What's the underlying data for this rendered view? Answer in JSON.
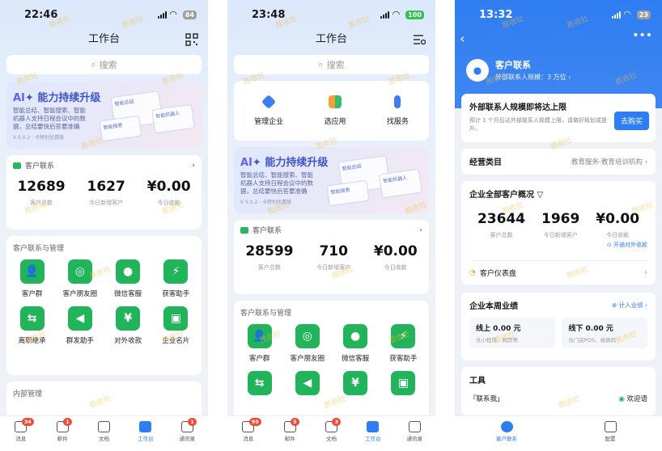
{
  "phone1": {
    "time": "22:46",
    "battery": "84",
    "title": "工作台",
    "search_placeholder": "搜索",
    "banner": {
      "title_ai": "AI",
      "title_rest": "能力持续升级",
      "desc": "智能总结、智能搜索、智能机器人支持日程会议中的数据，总结要快后答要准确",
      "ver": "V 5.0.2 · 卡特别优惠版",
      "cards": [
        "智能总结",
        "智能机器人",
        "智能搜索",
        "帮助中心"
      ]
    },
    "contacts": {
      "header": "客户联系",
      "stats": [
        {
          "value": "12689",
          "label": "客户总数"
        },
        {
          "value": "1627",
          "label": "今日新增客户"
        },
        {
          "value": "¥0.00",
          "label": "今日收款"
        }
      ]
    },
    "section": "客户联系与管理",
    "apps": [
      {
        "label": "客户群",
        "icon": "group-icon",
        "glyph": "👥"
      },
      {
        "label": "客户朋友圈",
        "icon": "moments-icon",
        "glyph": "◎"
      },
      {
        "label": "微信客服",
        "icon": "chat-icon",
        "glyph": "💬"
      },
      {
        "label": "获客助手",
        "icon": "bolt-icon",
        "glyph": "⚡"
      },
      {
        "label": "离职继承",
        "icon": "transfer-icon",
        "glyph": "⇆"
      },
      {
        "label": "群发助手",
        "icon": "megaphone-icon",
        "glyph": "📢"
      },
      {
        "label": "对外收款",
        "icon": "yen-icon",
        "glyph": "¥"
      },
      {
        "label": "企业名片",
        "icon": "card-icon",
        "glyph": "▣"
      }
    ],
    "section2": "内部管理",
    "tabs": [
      {
        "label": "消息",
        "badge": "34"
      },
      {
        "label": "邮件",
        "badge": "1"
      },
      {
        "label": "文档",
        "badge": ""
      },
      {
        "label": "工作台",
        "badge": ""
      },
      {
        "label": "通讯录",
        "badge": "1"
      }
    ]
  },
  "phone2": {
    "time": "23:48",
    "battery": "100",
    "title": "工作台",
    "search_placeholder": "搜索",
    "quick": [
      {
        "label": "管理企业",
        "icon": "hexagon-icon",
        "color": "#3c7df0"
      },
      {
        "label": "选应用",
        "icon": "apps-icon",
        "color": "#f0a23a"
      },
      {
        "label": "找服务",
        "icon": "tie-icon",
        "color": "#3c7df0"
      }
    ],
    "banner": {
      "title_ai": "AI",
      "title_rest": "能力持续升级",
      "desc": "智能总结、智能搜索、智能机器人支持日程会议中的数据，总结要快后答要准确",
      "ver": "V 5.0.2 · 卡特别优惠版",
      "cards": [
        "智能总结",
        "智能机器人",
        "智能搜索",
        "帮助中心"
      ]
    },
    "contacts": {
      "header": "客户联系",
      "stats": [
        {
          "value": "28599",
          "label": "客户总数"
        },
        {
          "value": "710",
          "label": "今日新增客户"
        },
        {
          "value": "¥0.00",
          "label": "今日收款"
        }
      ]
    },
    "section": "客户联系与管理",
    "apps": [
      {
        "label": "客户群",
        "icon": "group-icon",
        "glyph": "👥"
      },
      {
        "label": "客户朋友圈",
        "icon": "moments-icon",
        "glyph": "◎"
      },
      {
        "label": "微信客服",
        "icon": "chat-icon",
        "glyph": "💬"
      },
      {
        "label": "获客助手",
        "icon": "bolt-icon",
        "glyph": "⚡"
      },
      {
        "label": "",
        "icon": "transfer-icon",
        "glyph": "⇆"
      },
      {
        "label": "",
        "icon": "megaphone-icon",
        "glyph": "📢"
      },
      {
        "label": "",
        "icon": "yen-icon",
        "glyph": "¥"
      },
      {
        "label": "",
        "icon": "card-icon",
        "glyph": "▣"
      }
    ],
    "tabs": [
      {
        "label": "消息",
        "badge": "99"
      },
      {
        "label": "邮件",
        "badge": "5"
      },
      {
        "label": "文档",
        "badge": "3"
      },
      {
        "label": "工作台",
        "badge": ""
      },
      {
        "label": "通讯录",
        "badge": ""
      }
    ]
  },
  "phone3": {
    "time": "13:32",
    "battery": "23",
    "header_title": "客户联系",
    "header_sub": "外部联系人规模：3 万位 ›",
    "alert_title": "外部联系人规模即将达上限",
    "alert_desc": "预计 1 个月后达外部联系人规模上限，请做好规划或提升。",
    "buy_label": "去购买",
    "category_label": "经营类目",
    "category_value": "教育服务-教育培训机构 ›",
    "overview_title": "企业全部客户概况",
    "stats": [
      {
        "value": "23644",
        "label": "客户总数"
      },
      {
        "value": "1969",
        "label": "今日新增客户"
      },
      {
        "value": "¥0.00",
        "label": "今日收款"
      }
    ],
    "open_payment": "⊙ 开通对外收款",
    "dashboard": "客户仪表盘",
    "perf_title": "企业本周业绩",
    "perf_link": "⊕ 计入业绩 ›",
    "online": {
      "title": "线上 0.00 元",
      "desc": "含小程序、网页等"
    },
    "offline": {
      "title": "线下 0.00 元",
      "desc": "含门店POS、收款码"
    },
    "tools_title": "工具",
    "tool1": "「联系我」",
    "tool2": "欢迎语",
    "tabs": [
      {
        "label": "客户联系"
      },
      {
        "label": "配置"
      }
    ]
  },
  "watermark": "胜收社"
}
